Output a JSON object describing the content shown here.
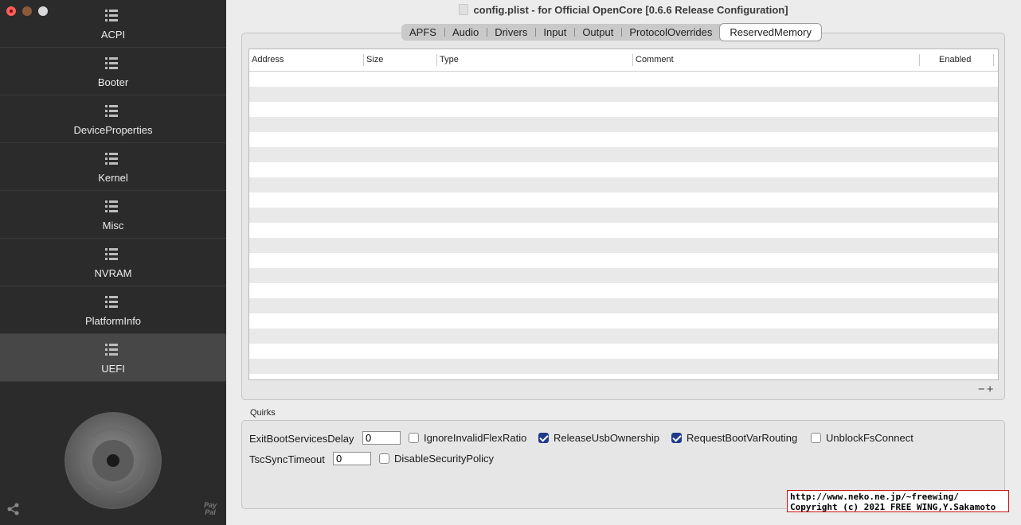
{
  "window": {
    "title": "config.plist - for Official OpenCore [0.6.6 Release Configuration]"
  },
  "sidebar": {
    "items": [
      {
        "label": "ACPI",
        "icon": "list-icon"
      },
      {
        "label": "Booter",
        "icon": "list-icon"
      },
      {
        "label": "DeviceProperties",
        "icon": "list-icon"
      },
      {
        "label": "Kernel",
        "icon": "list-icon"
      },
      {
        "label": "Misc",
        "icon": "list-icon"
      },
      {
        "label": "NVRAM",
        "icon": "list-icon"
      },
      {
        "label": "PlatformInfo",
        "icon": "list-icon"
      },
      {
        "label": "UEFI",
        "icon": "list-icon"
      }
    ],
    "selected": "UEFI",
    "footer": {
      "share_icon": "share-icon",
      "paypal_label_1": "Pay",
      "paypal_label_2": "Pal"
    }
  },
  "tabs": {
    "items": [
      "APFS",
      "Audio",
      "Drivers",
      "Input",
      "Output",
      "ProtocolOverrides",
      "ReservedMemory"
    ],
    "selected": "ReservedMemory"
  },
  "table": {
    "columns": [
      "Address",
      "Size",
      "Type",
      "Comment",
      "Enabled"
    ],
    "rows": [],
    "remove_label": "−",
    "add_label": "+"
  },
  "quirks": {
    "title": "Quirks",
    "exit_boot_services_delay": {
      "label": "ExitBootServicesDelay",
      "value": "0"
    },
    "tsc_sync_timeout": {
      "label": "TscSyncTimeout",
      "value": "0"
    },
    "checkboxes": [
      {
        "label": "IgnoreInvalidFlexRatio",
        "checked": false
      },
      {
        "label": "ReleaseUsbOwnership",
        "checked": true
      },
      {
        "label": "RequestBootVarRouting",
        "checked": true
      },
      {
        "label": "UnblockFsConnect",
        "checked": false
      },
      {
        "label": "DisableSecurityPolicy",
        "checked": false
      }
    ]
  },
  "copyright": {
    "line1": "http://www.neko.ne.jp/~freewing/",
    "line2": "Copyright (c) 2021 FREE WING,Y.Sakamoto"
  },
  "colors": {
    "sidebar_bg": "#2b2b2b",
    "sidebar_selected": "#474747",
    "checkbox_on": "#1e3a8a",
    "close_button": "#fe5f57"
  }
}
